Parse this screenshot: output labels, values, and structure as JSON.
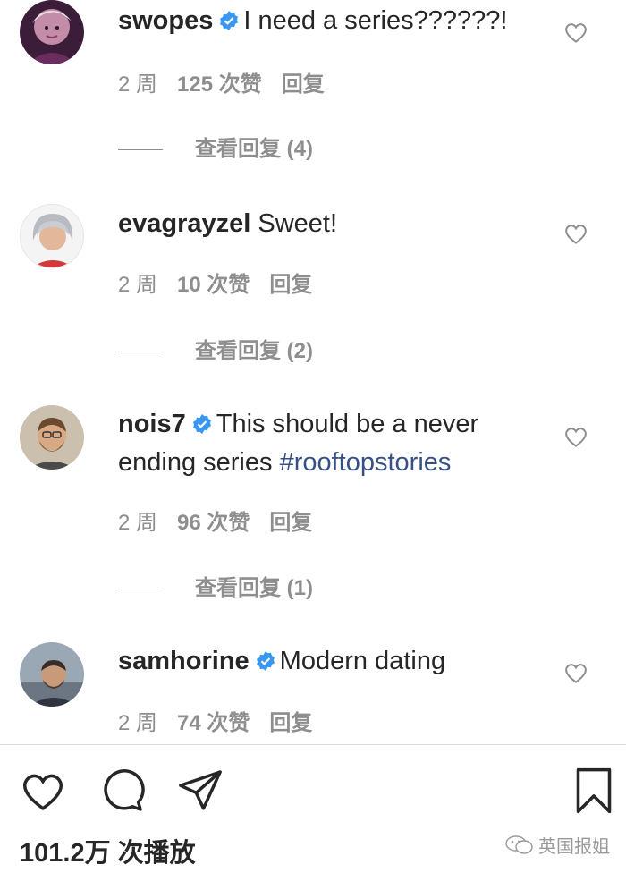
{
  "comments": [
    {
      "username": "swopes",
      "verified": true,
      "text": "I need a series??????!",
      "hashtag": "",
      "time": "2 周",
      "likes": "125 次赞",
      "reply_label": "回复",
      "view_replies": "查看回复 (4)"
    },
    {
      "username": "evagrayzel",
      "verified": false,
      "text": "Sweet!",
      "hashtag": "",
      "time": "2 周",
      "likes": "10 次赞",
      "reply_label": "回复",
      "view_replies": "查看回复 (2)"
    },
    {
      "username": "nois7",
      "verified": true,
      "text": "This should be a never ending series",
      "hashtag": "#rooftopstories",
      "time": "2 周",
      "likes": "96 次赞",
      "reply_label": "回复",
      "view_replies": "查看回复 (1)"
    },
    {
      "username": "samhorine",
      "verified": true,
      "text": "Modern dating",
      "hashtag": "",
      "time": "2 周",
      "likes": "74 次赞",
      "reply_label": "回复",
      "view_replies": ""
    }
  ],
  "footer": {
    "views": "101.2万 次播放",
    "watermark": "英国报姐"
  },
  "icons": {
    "like": "heart-icon",
    "comment": "comment-icon",
    "share": "share-icon",
    "save": "bookmark-icon",
    "verified": "verified-badge-icon"
  },
  "colors": {
    "verified": "#3897f0",
    "hashtag": "#385185",
    "secondary_text": "#8e8e8e"
  }
}
